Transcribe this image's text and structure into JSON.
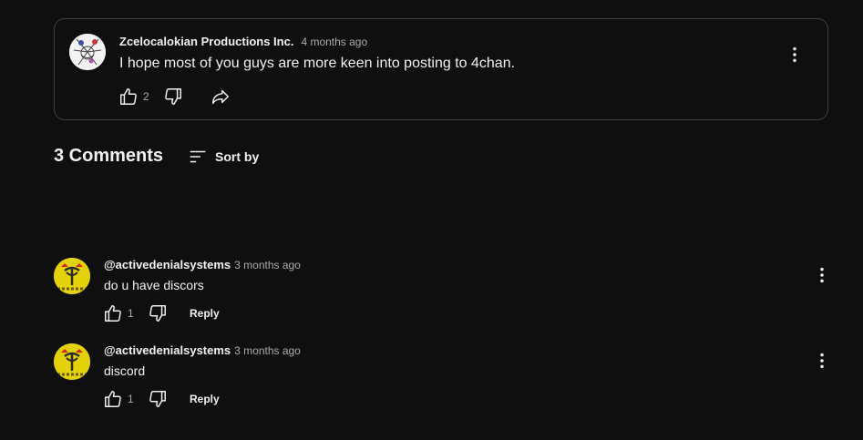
{
  "post": {
    "author": "Zcelocalokian Productions Inc.",
    "time": "4 months ago",
    "text": "I hope most of you guys are more keen into posting to 4chan.",
    "likes": "2"
  },
  "comments_header": {
    "count_label": "3 Comments",
    "sort_label": "Sort by"
  },
  "comments": [
    {
      "author": "@activedenialsystems",
      "time": "3 months ago",
      "text": "do u have discors",
      "likes": "1",
      "reply_label": "Reply"
    },
    {
      "author": "@activedenialsystems",
      "time": "3 months ago",
      "text": "discord",
      "likes": "1",
      "reply_label": "Reply"
    }
  ],
  "icons": {
    "like": "thumbs-up-icon",
    "dislike": "thumbs-down-icon",
    "share": "share-icon",
    "more": "more-vert-icon",
    "sort": "sort-icon"
  },
  "colors": {
    "background": "#0f0f0f",
    "text_primary": "#f1f1f1",
    "text_secondary": "#aaaaaa",
    "card_border": "#3f3f3f",
    "avatar_yellow": "#e3d20a"
  }
}
